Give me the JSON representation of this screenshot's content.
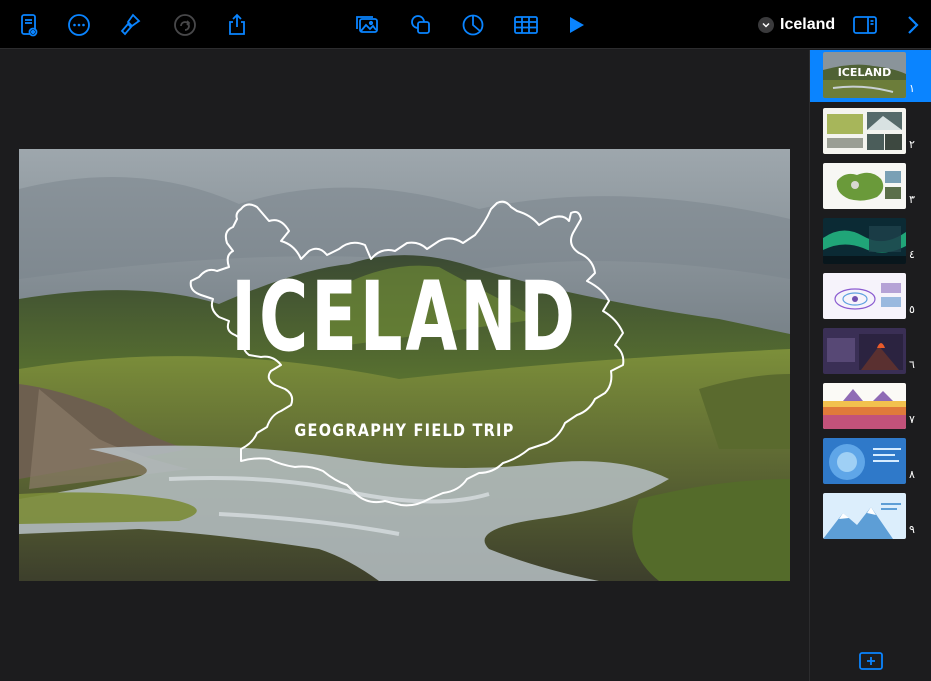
{
  "toolbar": {
    "left_icons": [
      "presenter-notes-icon",
      "more-icon",
      "format-brush-icon",
      "redo-icon",
      "share-icon"
    ],
    "center_icons": [
      "media-icon",
      "shapes-icon",
      "chart-icon",
      "table-icon",
      "play-icon"
    ],
    "document_title": "Iceland",
    "right_icons": [
      "chevron-down-icon",
      "sidebar-toggle-icon",
      "chevron-right-icon"
    ],
    "accent_color": "#0a84ff"
  },
  "slide": {
    "title": "ICELAND",
    "subtitle": "GEOGRAPHY FIELD TRIP"
  },
  "navigator": {
    "slides": [
      {
        "number": "١",
        "selected": true
      },
      {
        "number": "٢",
        "selected": false
      },
      {
        "number": "٣",
        "selected": false
      },
      {
        "number": "٤",
        "selected": false
      },
      {
        "number": "٥",
        "selected": false
      },
      {
        "number": "٦",
        "selected": false
      },
      {
        "number": "٧",
        "selected": false
      },
      {
        "number": "٨",
        "selected": false
      },
      {
        "number": "٩",
        "selected": false
      }
    ],
    "add_slide_icon": "add-slide-icon"
  }
}
